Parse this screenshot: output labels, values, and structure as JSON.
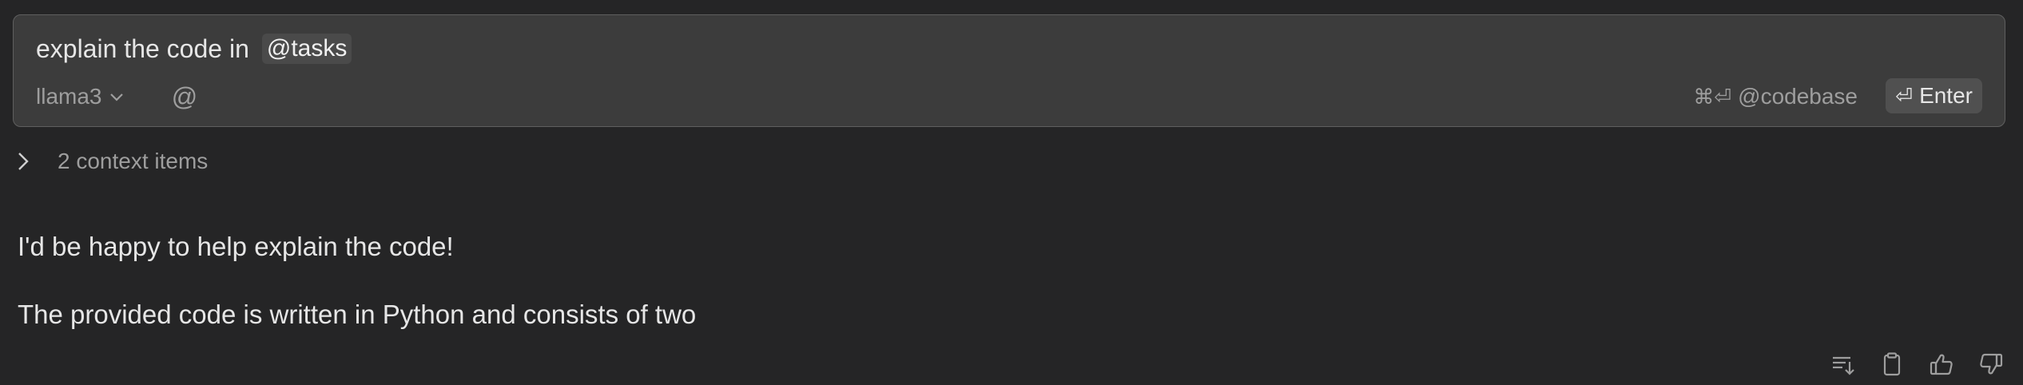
{
  "input": {
    "prompt_text": "explain the code in",
    "mention": "@tasks",
    "model": "llama3",
    "at_symbol": "@",
    "codebase_keys": "⌘⏎",
    "codebase_label": "@codebase",
    "enter_symbol": "⏎",
    "enter_label": "Enter"
  },
  "context": {
    "label": "2 context items"
  },
  "response": {
    "paragraphs": [
      "I'd be happy to help explain the code!",
      "The provided code is written in Python and consists of two"
    ]
  },
  "icons": {
    "model_chevron": "chevron-down-icon",
    "context_chevron": "chevron-right-icon",
    "actions": [
      "insert-at-cursor-icon",
      "clipboard-icon",
      "thumbs-up-icon",
      "thumbs-down-icon"
    ]
  },
  "colors": {
    "background": "#252526",
    "input_background": "#3c3c3c",
    "input_border": "#5f5f5f",
    "muted_text": "#9e9e9e",
    "primary_text": "#e6e6e6"
  }
}
